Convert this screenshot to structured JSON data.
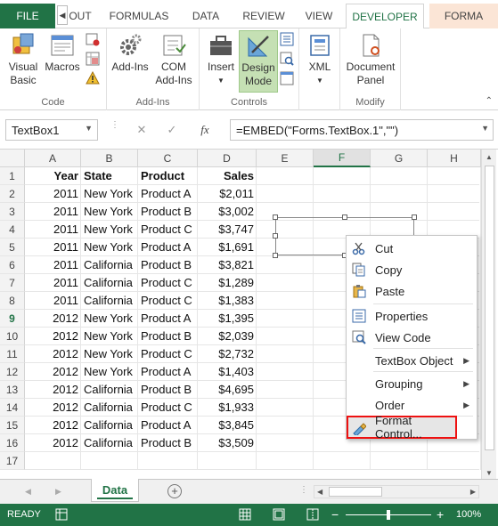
{
  "tabs": {
    "file": "FILE",
    "scroll_left": "◀",
    "items": [
      "OUT",
      "FORMULAS",
      "DATA",
      "REVIEW",
      "VIEW",
      "DEVELOPER",
      "FORMA"
    ],
    "active": "DEVELOPER"
  },
  "ribbon": {
    "groups": [
      {
        "name": "Code",
        "buttons": [
          {
            "label": "Visual\nBasic"
          },
          {
            "label": "Macros"
          }
        ]
      },
      {
        "name": "Add-Ins",
        "buttons": [
          {
            "label": "Add-Ins"
          },
          {
            "label": "COM\nAdd-Ins"
          }
        ]
      },
      {
        "name": "Controls",
        "buttons": [
          {
            "label": "Insert"
          },
          {
            "label": "Design\nMode"
          }
        ]
      },
      {
        "name": "",
        "buttons": [
          {
            "label": "XML"
          }
        ]
      },
      {
        "name": "Modify",
        "buttons": [
          {
            "label": "Document\nPanel"
          }
        ]
      }
    ],
    "visual_basic": "Visual",
    "visual_basic2": "Basic",
    "macros": "Macros",
    "code_group": "Code",
    "addins": "Add-Ins",
    "com": "COM",
    "com2": "Add-Ins",
    "addins_group": "Add-Ins",
    "insert": "Insert",
    "design": "Design",
    "design2": "Mode",
    "controls_group": "Controls",
    "xml": "XML",
    "document": "Document",
    "document2": "Panel",
    "modify_group": "Modify"
  },
  "formula_bar": {
    "name_box": "TextBox1",
    "cancel": "✕",
    "enter": "✓",
    "fx": "fx",
    "formula": "=EMBED(\"Forms.TextBox.1\",\"\")"
  },
  "columns": [
    "A",
    "B",
    "C",
    "D",
    "E",
    "F",
    "G",
    "H"
  ],
  "selected_column": "F",
  "rows": [
    "1",
    "2",
    "3",
    "4",
    "5",
    "6",
    "7",
    "8",
    "9",
    "10",
    "11",
    "12",
    "13",
    "14",
    "15",
    "16",
    "17"
  ],
  "selected_row": "9",
  "table": {
    "headers": [
      "Year",
      "State",
      "Product",
      "Sales"
    ],
    "data": [
      [
        "2011",
        "New York",
        "Product A",
        "$2,011"
      ],
      [
        "2011",
        "New York",
        "Product B",
        "$3,002"
      ],
      [
        "2011",
        "New York",
        "Product C",
        "$3,747"
      ],
      [
        "2011",
        "New York",
        "Product A",
        "$1,691"
      ],
      [
        "2011",
        "California",
        "Product B",
        "$3,821"
      ],
      [
        "2011",
        "California",
        "Product C",
        "$1,289"
      ],
      [
        "2011",
        "California",
        "Product C",
        "$1,383"
      ],
      [
        "2012",
        "New York",
        "Product A",
        "$1,395"
      ],
      [
        "2012",
        "New York",
        "Product B",
        "$2,039"
      ],
      [
        "2012",
        "New York",
        "Product C",
        "$2,732"
      ],
      [
        "2012",
        "New York",
        "Product A",
        "$1,403"
      ],
      [
        "2012",
        "California",
        "Product B",
        "$4,695"
      ],
      [
        "2012",
        "California",
        "Product C",
        "$1,933"
      ],
      [
        "2012",
        "California",
        "Product A",
        "$3,845"
      ],
      [
        "2012",
        "California",
        "Product B",
        "$3,509"
      ]
    ]
  },
  "context_menu": {
    "cut": "Cut",
    "copy": "Copy",
    "paste": "Paste",
    "properties": "Properties",
    "view_code": "View Code",
    "textbox_object": "TextBox Object",
    "grouping": "Grouping",
    "order": "Order",
    "format_control": "Format Control..."
  },
  "sheet_tab": "Data",
  "status": {
    "ready": "READY",
    "zoom": "100%",
    "minus": "−",
    "plus": "+"
  },
  "colors": {
    "accent": "#217346",
    "highlight_border": "#ee1111",
    "design_mode_bg": "#c5e0b4"
  }
}
